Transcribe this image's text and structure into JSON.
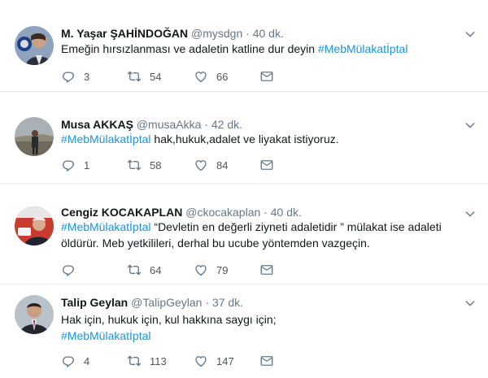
{
  "tweets": [
    {
      "name": "M. Yaşar ŞAHİNDOĞAN",
      "handle": "@mysdgn",
      "dot": "·",
      "time": "40 dk.",
      "text_parts": [
        "Emeğin hırsızlanması ve adaletin katline dur deyin ",
        "#MebMülakatİptal"
      ],
      "replies": "3",
      "retweets": "54",
      "likes": "66"
    },
    {
      "name": "Musa AKKAŞ",
      "handle": "@musaAkka",
      "dot": "·",
      "time": "42 dk.",
      "text_parts": [
        "#MebMülakatİptal",
        " hak,hukuk,adalet ve liyakat istiyoruz."
      ],
      "replies": "1",
      "retweets": "58",
      "likes": "84"
    },
    {
      "name": "Cengiz KOCAKAPLAN",
      "handle": "@ckocakaplan",
      "dot": "·",
      "time": "40 dk.",
      "text_line1": [
        "#MebMülakatİptal",
        " “Devletin en değerli ziyneti adaletidir ” mülakat ise adaleti"
      ],
      "text_line2": "öldürür. Meb yetkilileri, derhal bu ucube yöntemden vazgeçin.",
      "replies": "",
      "retweets": "64",
      "likes": "79"
    },
    {
      "name": "Talip Geylan",
      "handle": "@TalipGeylan",
      "dot": "·",
      "time": "37 dk.",
      "text_line1": "Hak için, hukuk için, kul hakkına saygı için;",
      "text_line2": "#MebMülakatİptal",
      "replies": "4",
      "retweets": "113",
      "likes": "147"
    }
  ],
  "colors": {
    "hashtag": "#1b95e0",
    "muted": "#657786",
    "text": "#14171a",
    "divider": "#e6ecf0"
  },
  "icons": [
    "reply-icon",
    "retweet-icon",
    "like-icon",
    "direct-message-icon",
    "chevron-down-icon"
  ]
}
